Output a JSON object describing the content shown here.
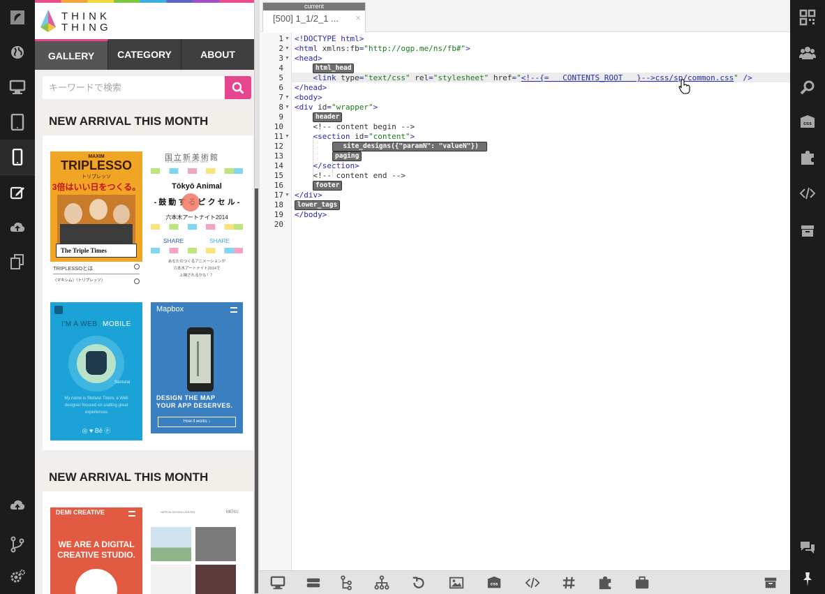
{
  "left_sidebar": {
    "items": [
      "logo",
      "globe",
      "desktop",
      "tablet",
      "mobile",
      "edit",
      "cloud-upload",
      "copy",
      "cloud-upload-alt",
      "git-branch",
      "settings"
    ],
    "active": "mobile"
  },
  "preview": {
    "logo": {
      "line1": "THINK",
      "line2": "THING"
    },
    "nav": [
      {
        "label": "GALLERY",
        "active": true
      },
      {
        "label": "CATEGORY",
        "active": false
      },
      {
        "label": "ABOUT",
        "active": false
      }
    ],
    "search": {
      "placeholder": "キーワードで検索"
    },
    "sections": [
      {
        "title": "NEW ARRIVAL THIS MONTH"
      },
      {
        "title": "NEW ARRIVAL THIS MONTH"
      }
    ],
    "thumbs": {
      "triplesso": {
        "brand": "MAXIM",
        "title": "TRIPLESSO",
        "kana": "トリプレッソ",
        "tagline": "3倍はいい日をつくる。",
        "paper": "The Triple Times",
        "row1": "TRIPLESSOとは",
        "row2": "〈マキシム〉〈トリプレッソ〉"
      },
      "tokyo": {
        "org": "国立新美術館",
        "org_en": "THE NATIONAL ART CENTER, TOKYO",
        "title": "Tōkyō Animal",
        "subtitle": "- 鼓 動 す る ピ ク セ ル -",
        "event": "六本木アートナイト2014",
        "share1": "SHARE",
        "share2": "SHARE",
        "desc1": "あなたのつくるアニメーションが",
        "desc2": "六本木アートナイト2014で",
        "desc3": "上映されるかも！？"
      },
      "webmobile": {
        "title_a": "I'M A WEB ",
        "title_b": "MOBILE",
        "sign": "Samurai",
        "bio1": "My name is Stefano Tirloni, a Web",
        "bio2": "designer focused on crafting great",
        "bio3": "experiences",
        "icons": "◎   ♥   Bē   ⓟ"
      },
      "mapbox": {
        "title": "Mapbox",
        "head1": "DESIGN THE MAP",
        "head2": "YOUR APP DESERVES.",
        "button": "How it works ↓"
      },
      "demi": {
        "brand": "DEMI CREATIVE",
        "head1": "WE ARE A DIGITAL",
        "head2": "CREATIVE STUDIO."
      },
      "nippon": {
        "brand": "NIPPON DESIGN CENTER",
        "menu": "MENU"
      }
    }
  },
  "editor": {
    "tab": {
      "badge": "current",
      "label": "[500] 1_1/2_1 ...",
      "close": "×"
    },
    "lines": [
      {
        "n": "1",
        "fold": true,
        "html": "<span>&lt;!DOCTYPE html&gt;</span>"
      },
      {
        "n": "2",
        "fold": true,
        "html": "&lt;html <span class='at'>xmlns:fb</span>=<span class='str'>\"http://ogp.me/ns/fb#\"</span>&gt;"
      },
      {
        "n": "3",
        "fold": true,
        "html": "&lt;head&gt;"
      },
      {
        "n": "4",
        "fold": false,
        "html": ""
      },
      {
        "n": "5",
        "fold": false,
        "html": "    &lt;link <span class='at'>type</span>=<span class='str'>\"text/css\"</span> <span class='at'>rel</span>=<span class='str'>\"stylesheet\"</span> <span class='at'>href</span>=<span class='str'>\"</span><span class='lnk'>&lt;!--{=   CONTENTS_ROOT   }--&gt;css/sp/common.css</span><span class='str'>\"</span> /&gt;"
      },
      {
        "n": "6",
        "fold": false,
        "html": "&lt;/head&gt;"
      },
      {
        "n": "7",
        "fold": true,
        "html": "&lt;body&gt;"
      },
      {
        "n": "8",
        "fold": true,
        "html": "&lt;div <span class='at'>id</span>=<span class='str'>\"wrapper\"</span>&gt;"
      },
      {
        "n": "9",
        "fold": false,
        "html": ""
      },
      {
        "n": "10",
        "fold": false,
        "html": "    <span class='cm'>&lt;!-- content begin --&gt;</span>"
      },
      {
        "n": "11",
        "fold": true,
        "html": "    &lt;section <span class='at'>id</span>=<span class='str'>\"content\"</span>&gt;"
      },
      {
        "n": "12",
        "fold": false,
        "html": ""
      },
      {
        "n": "13",
        "fold": false,
        "html": ""
      },
      {
        "n": "14",
        "fold": false,
        "html": "    &lt;/section&gt;"
      },
      {
        "n": "15",
        "fold": false,
        "html": "    <span class='cm'>&lt;!-- content end --&gt;</span>"
      },
      {
        "n": "16",
        "fold": false,
        "html": ""
      },
      {
        "n": "17",
        "fold": true,
        "html": "&lt;/div&gt;"
      },
      {
        "n": "18",
        "fold": false,
        "html": ""
      },
      {
        "n": "19",
        "fold": false,
        "html": "&lt;/body&gt;"
      },
      {
        "n": "20",
        "fold": false,
        "html": ""
      }
    ],
    "chips": {
      "html_head": "html_head",
      "header": "header",
      "site_designs": "  site_designs({\"paramN\": \"valueN\"})  ",
      "paging": "paging",
      "footer": "footer",
      "lower_tags": "lower_tags"
    }
  },
  "bottom_toolbar": {
    "items": [
      "desktop",
      "layers",
      "tree",
      "sitemap",
      "history",
      "image",
      "css",
      "code",
      "hash",
      "puzzle",
      "briefcase",
      "archive"
    ]
  },
  "right_sidebar": {
    "items": [
      "qr-code",
      "users",
      "search",
      "css",
      "puzzle",
      "code",
      "archive",
      "chat",
      "pin"
    ],
    "css_label": "css"
  },
  "colors": {
    "accent": "#e5468f",
    "sidebar": "#1c1c1c",
    "chip": "#6e6e6e"
  }
}
